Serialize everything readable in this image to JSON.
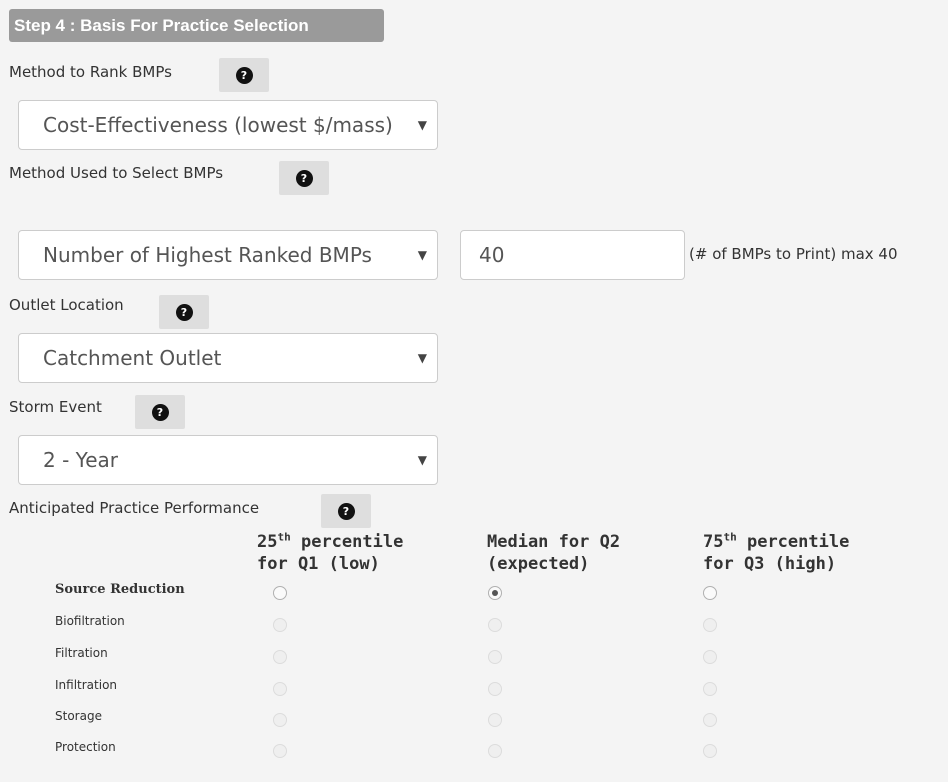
{
  "step": {
    "title": "Step 4 : Basis For Practice Selection"
  },
  "help_icon": {
    "glyph": "?",
    "name": "help-icon"
  },
  "rank_method": {
    "label": "Method to Rank BMPs",
    "selected": "Cost-Effectiveness (lowest $/mass)"
  },
  "select_method": {
    "label": "Method Used to Select BMPs",
    "selected": "Number of Highest Ranked BMPs",
    "count_value": "40",
    "count_hint": "(# of BMPs to Print) max 40"
  },
  "outlet": {
    "label": "Outlet Location",
    "selected": "Catchment Outlet"
  },
  "storm": {
    "label": "Storm Event",
    "selected": "2 - Year"
  },
  "performance": {
    "label": "Anticipated Practice Performance",
    "columns": [
      {
        "line1_pre": "25",
        "line1_sup": "th",
        "line1_post": " percentile",
        "line2": "for Q1 (low)"
      },
      {
        "line1_pre": "Median for Q2",
        "line1_sup": "",
        "line1_post": "",
        "line2": "(expected)"
      },
      {
        "line1_pre": "75",
        "line1_sup": "th",
        "line1_post": " percentile",
        "line2": "for Q3 (high)"
      }
    ],
    "rows": [
      {
        "label": "Source Reduction",
        "selected_column": 1
      },
      {
        "label": "Biofiltration"
      },
      {
        "label": "Filtration"
      },
      {
        "label": "Infiltration"
      },
      {
        "label": "Storage"
      },
      {
        "label": "Protection"
      }
    ]
  }
}
